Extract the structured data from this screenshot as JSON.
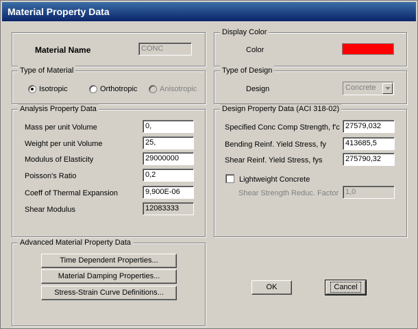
{
  "window": {
    "title": "Material Property Data"
  },
  "material_name": {
    "label": "Material Name",
    "value": "CONC"
  },
  "display_color": {
    "legend": "Display Color",
    "label": "Color",
    "color": "#ff0000"
  },
  "type_of_material": {
    "legend": "Type of Material",
    "options": [
      {
        "label": "Isotropic",
        "checked": true,
        "enabled": true
      },
      {
        "label": "Orthotropic",
        "checked": false,
        "enabled": true
      },
      {
        "label": "Anisotropic",
        "checked": false,
        "enabled": false
      }
    ]
  },
  "type_of_design": {
    "legend": "Type of Design",
    "label": "Design",
    "value": "Concrete"
  },
  "analysis": {
    "legend": "Analysis Property Data",
    "rows": [
      {
        "label": "Mass per unit Volume",
        "value": "0,"
      },
      {
        "label": "Weight per unit Volume",
        "value": "25,"
      },
      {
        "label": "Modulus of Elasticity",
        "value": "29000000"
      },
      {
        "label": "Poisson's Ratio",
        "value": "0,2"
      },
      {
        "label": "Coeff of Thermal Expansion",
        "value": "9,900E-06"
      },
      {
        "label": "Shear Modulus",
        "value": "12083333"
      }
    ]
  },
  "design": {
    "legend": "Design Property Data (ACI 318-02)",
    "rows": [
      {
        "label": "Specified Conc Comp Strength, f'c",
        "value": "27579,032"
      },
      {
        "label": "Bending Reinf. Yield Stress, fy",
        "value": "413685,5"
      },
      {
        "label": "Shear Reinf. Yield Stress, fys",
        "value": "275790,32"
      }
    ],
    "lightweight_label": "Lightweight Concrete",
    "shear_factor_label": "Shear Strength Reduc. Factor",
    "shear_factor_value": "1,0"
  },
  "advanced": {
    "legend": "Advanced Material Property Data",
    "buttons": [
      "Time Dependent Properties...",
      "Material Damping Properties...",
      "Stress-Strain Curve Definitions..."
    ]
  },
  "actions": {
    "ok": "OK",
    "cancel": "Cancel"
  }
}
